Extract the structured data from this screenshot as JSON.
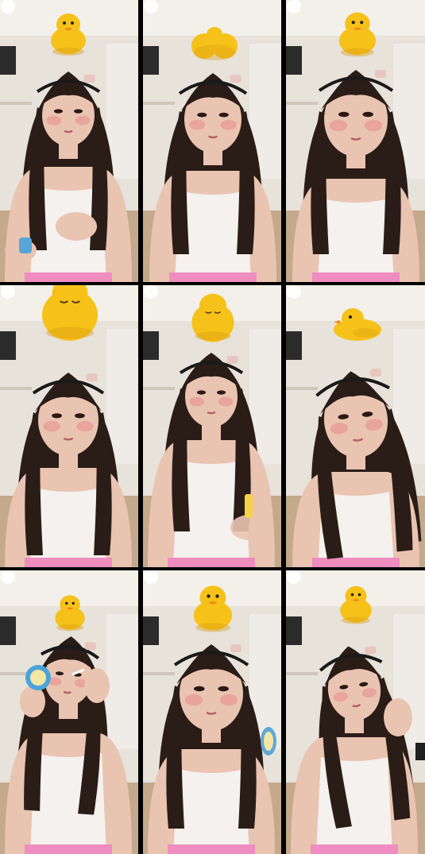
{
  "layout": {
    "rows": 3,
    "cols": 3
  },
  "tiles": [
    {
      "id": "frame-1",
      "duck": "yellow-duck",
      "pose": "looking-down-holding-item"
    },
    {
      "id": "frame-2",
      "duck": "duck-back-view",
      "pose": "looking-forward"
    },
    {
      "id": "frame-3",
      "duck": "yellow-duck",
      "pose": "looking-forward-close"
    },
    {
      "id": "frame-4",
      "duck": "big-sleeping-duck",
      "pose": "looking-forward"
    },
    {
      "id": "frame-5",
      "duck": "sleeping-duck",
      "pose": "looking-forward-hands-low"
    },
    {
      "id": "frame-6",
      "duck": "yellow-duck-flat",
      "pose": "head-tilted"
    },
    {
      "id": "frame-7",
      "duck": "yellow-duck",
      "pose": "applying-makeup"
    },
    {
      "id": "frame-8",
      "duck": "yellow-duck-large",
      "pose": "looking-forward-holding-item"
    },
    {
      "id": "frame-9",
      "duck": "yellow-duck",
      "pose": "waving"
    }
  ],
  "colors": {
    "wall": "#e7e2da",
    "ceiling": "#f3f0ea",
    "duck": "#f6c21a",
    "duck_shadow": "#d99b10",
    "beak": "#f08a1a",
    "hair": "#2a1c16",
    "skin": "#e9c4b1",
    "cheek": "#e98f8f",
    "top": "#f4f1ee",
    "pink": "#ef8cc0",
    "floor": "#a87a4c",
    "tv": "#2b2b2b"
  }
}
